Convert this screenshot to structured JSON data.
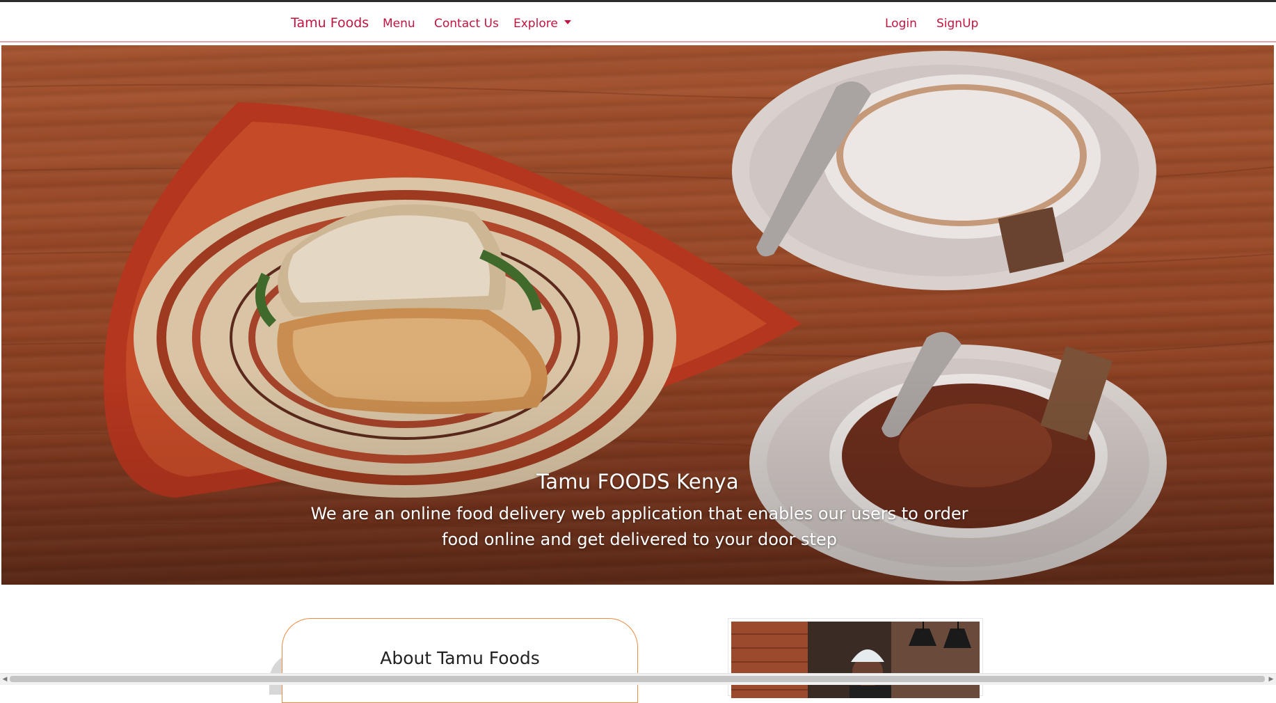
{
  "nav": {
    "brand": "Tamu Foods",
    "menu": "Menu",
    "contact": "Contact Us",
    "explore": "Explore",
    "login": "Login",
    "signup": "SignUp"
  },
  "hero": {
    "title": "Tamu FOODS Kenya",
    "text": "We are an online food delivery web application that enables our users to order food online and get delivered to your door step"
  },
  "about": {
    "title": "About Tamu Foods"
  },
  "colors": {
    "accent": "#c2143f",
    "card_border": "#ee8a40"
  },
  "icons": {
    "explore_caret": "caret-down-icon",
    "scroll_left": "scroll-left-arrow-icon",
    "scroll_right": "scroll-right-arrow-icon"
  }
}
